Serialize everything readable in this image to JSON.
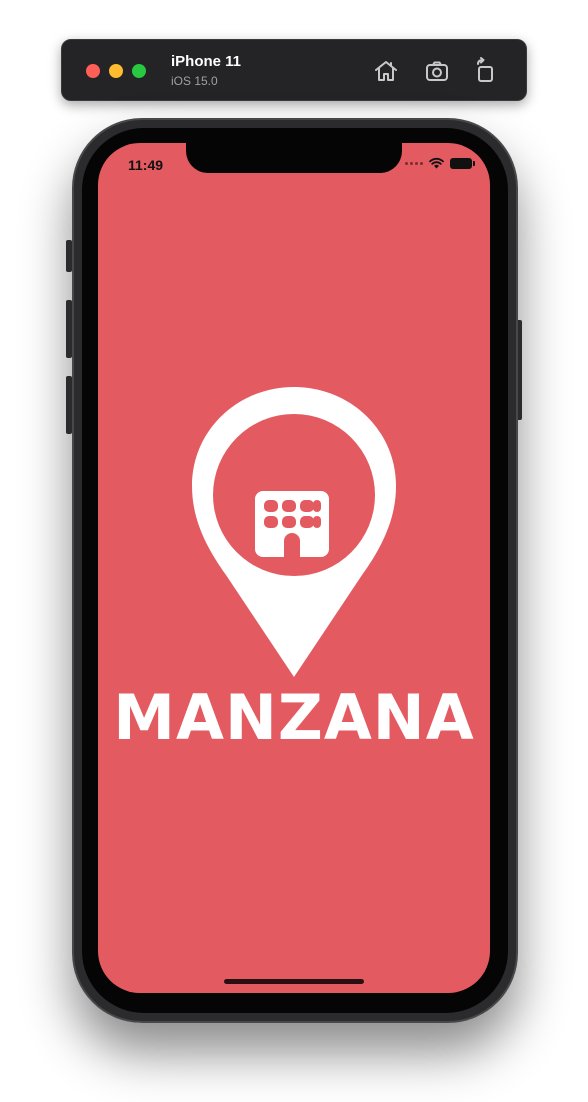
{
  "simulator": {
    "device_name": "iPhone 11",
    "os_version": "iOS 15.0",
    "icons": [
      "home-icon",
      "screenshot-icon",
      "rotate-icon"
    ]
  },
  "status_bar": {
    "time": "11:49"
  },
  "splash": {
    "pin_label": "HOTEL",
    "brand_name": "MANZANA"
  },
  "colors": {
    "background": "#e45a61",
    "logo": "#ffffff"
  }
}
